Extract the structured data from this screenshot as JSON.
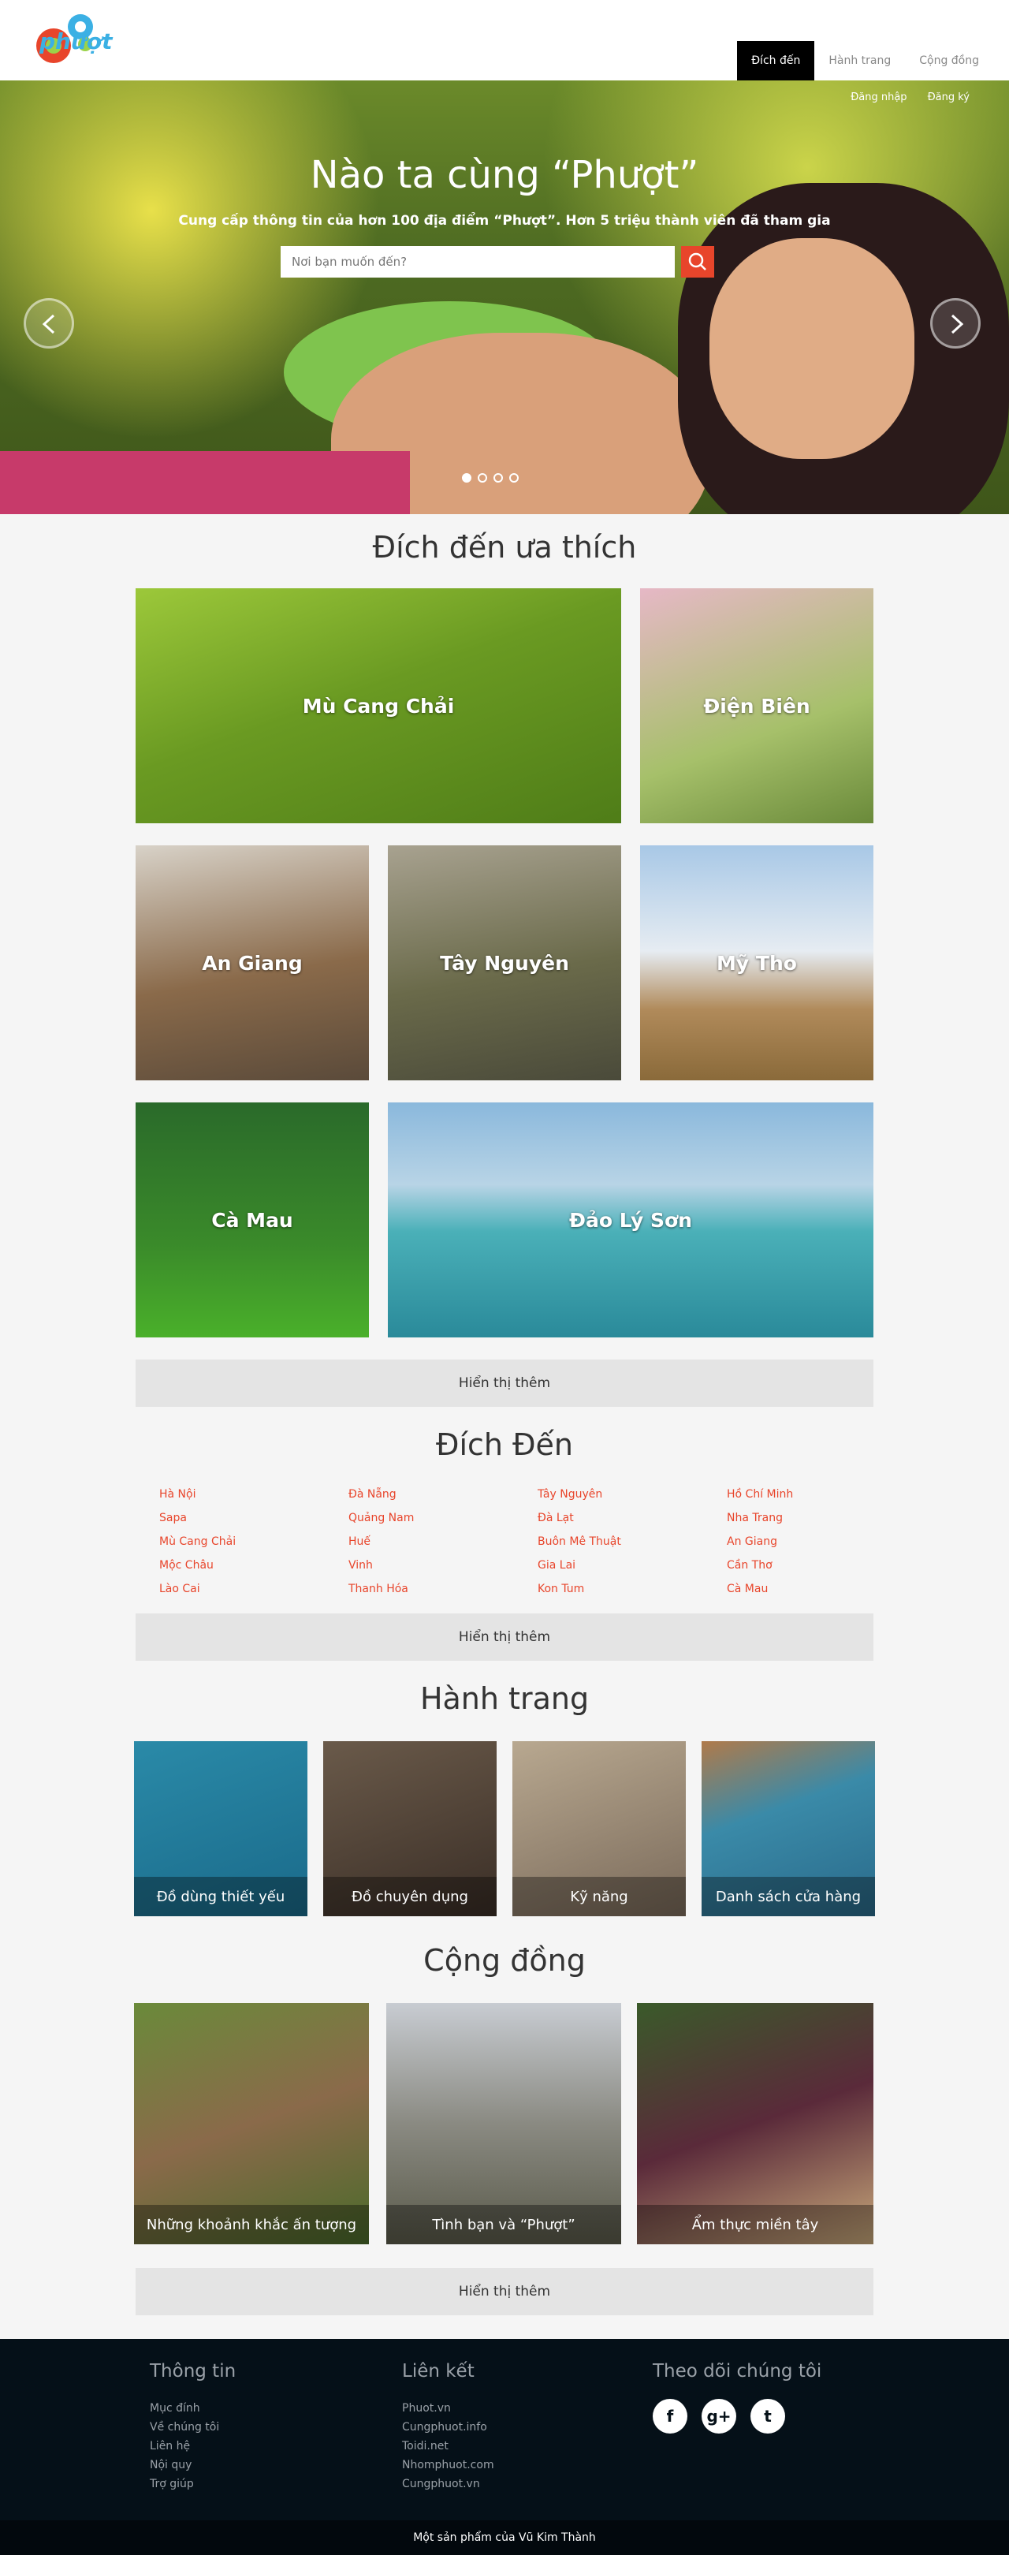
{
  "brand": {
    "logo_text": "phượt"
  },
  "nav": {
    "items": [
      "Đích đến",
      "Hành trang",
      "Cộng đồng"
    ]
  },
  "auth": {
    "login": "Đăng nhập",
    "register": "Đăng ký"
  },
  "hero": {
    "title": "Nào ta cùng “Phượt”",
    "subtitle": "Cung cấp thông tin của hơn 100 địa điểm “Phượt”. Hơn 5 triệu thành viên đã tham gia",
    "search_placeholder": "Nơi bạn muốn đến?"
  },
  "favorites": {
    "title": "Đích đến ưa thích",
    "tiles": [
      "Mù Cang Chải",
      "Điện Biên",
      "An Giang",
      "Tây Nguyên",
      "Mỹ Tho",
      "Cà Mau",
      "Đảo Lý Sơn"
    ],
    "more": "Hiển thị thêm"
  },
  "destinations": {
    "title": "Đích Đến",
    "columns": [
      [
        "Hà Nội",
        "Sapa",
        "Mù Cang Chải",
        "Mộc Châu",
        "Lào Cai"
      ],
      [
        "Đà Nẵng",
        "Quảng Nam",
        "Huế",
        "Vinh",
        "Thanh Hóa"
      ],
      [
        "Tây Nguyên",
        "Đà Lạt",
        "Buôn Mê Thuật",
        "Gia Lai",
        "Kon Tum"
      ],
      [
        "Hồ Chí Minh",
        "Nha Trang",
        "An Giang",
        "Cần Thơ",
        "Cà Mau"
      ]
    ],
    "more": "Hiển thị thêm"
  },
  "gear": {
    "title": "Hành trang",
    "tiles": [
      "Đồ dùng thiết yếu",
      "Đồ chuyên dụng",
      "Kỹ năng",
      "Danh sách cửa hàng"
    ]
  },
  "community": {
    "title": "Cộng đồng",
    "tiles": [
      "Những khoảnh khắc ấn tượng",
      "Tình bạn và “Phượt”",
      "Ẩm thực miền tây"
    ],
    "more": "Hiển thị thêm"
  },
  "footer": {
    "info_title": "Thông tin",
    "info_links": [
      "Mục đính",
      "Về chúng tôi",
      "Liên hệ",
      "Nội quy",
      "Trợ giúp"
    ],
    "links_title": "Liên kết",
    "links": [
      "Phuot.vn",
      "Cungphuot.info",
      "Toidi.net",
      "Nhomphuot.com",
      "Cungphuot.vn"
    ],
    "follow_title": "Theo dõi chúng tôi",
    "social": [
      "f",
      "g+",
      "t"
    ],
    "credit": "Một sản phẩm của Vũ Kim Thành"
  }
}
